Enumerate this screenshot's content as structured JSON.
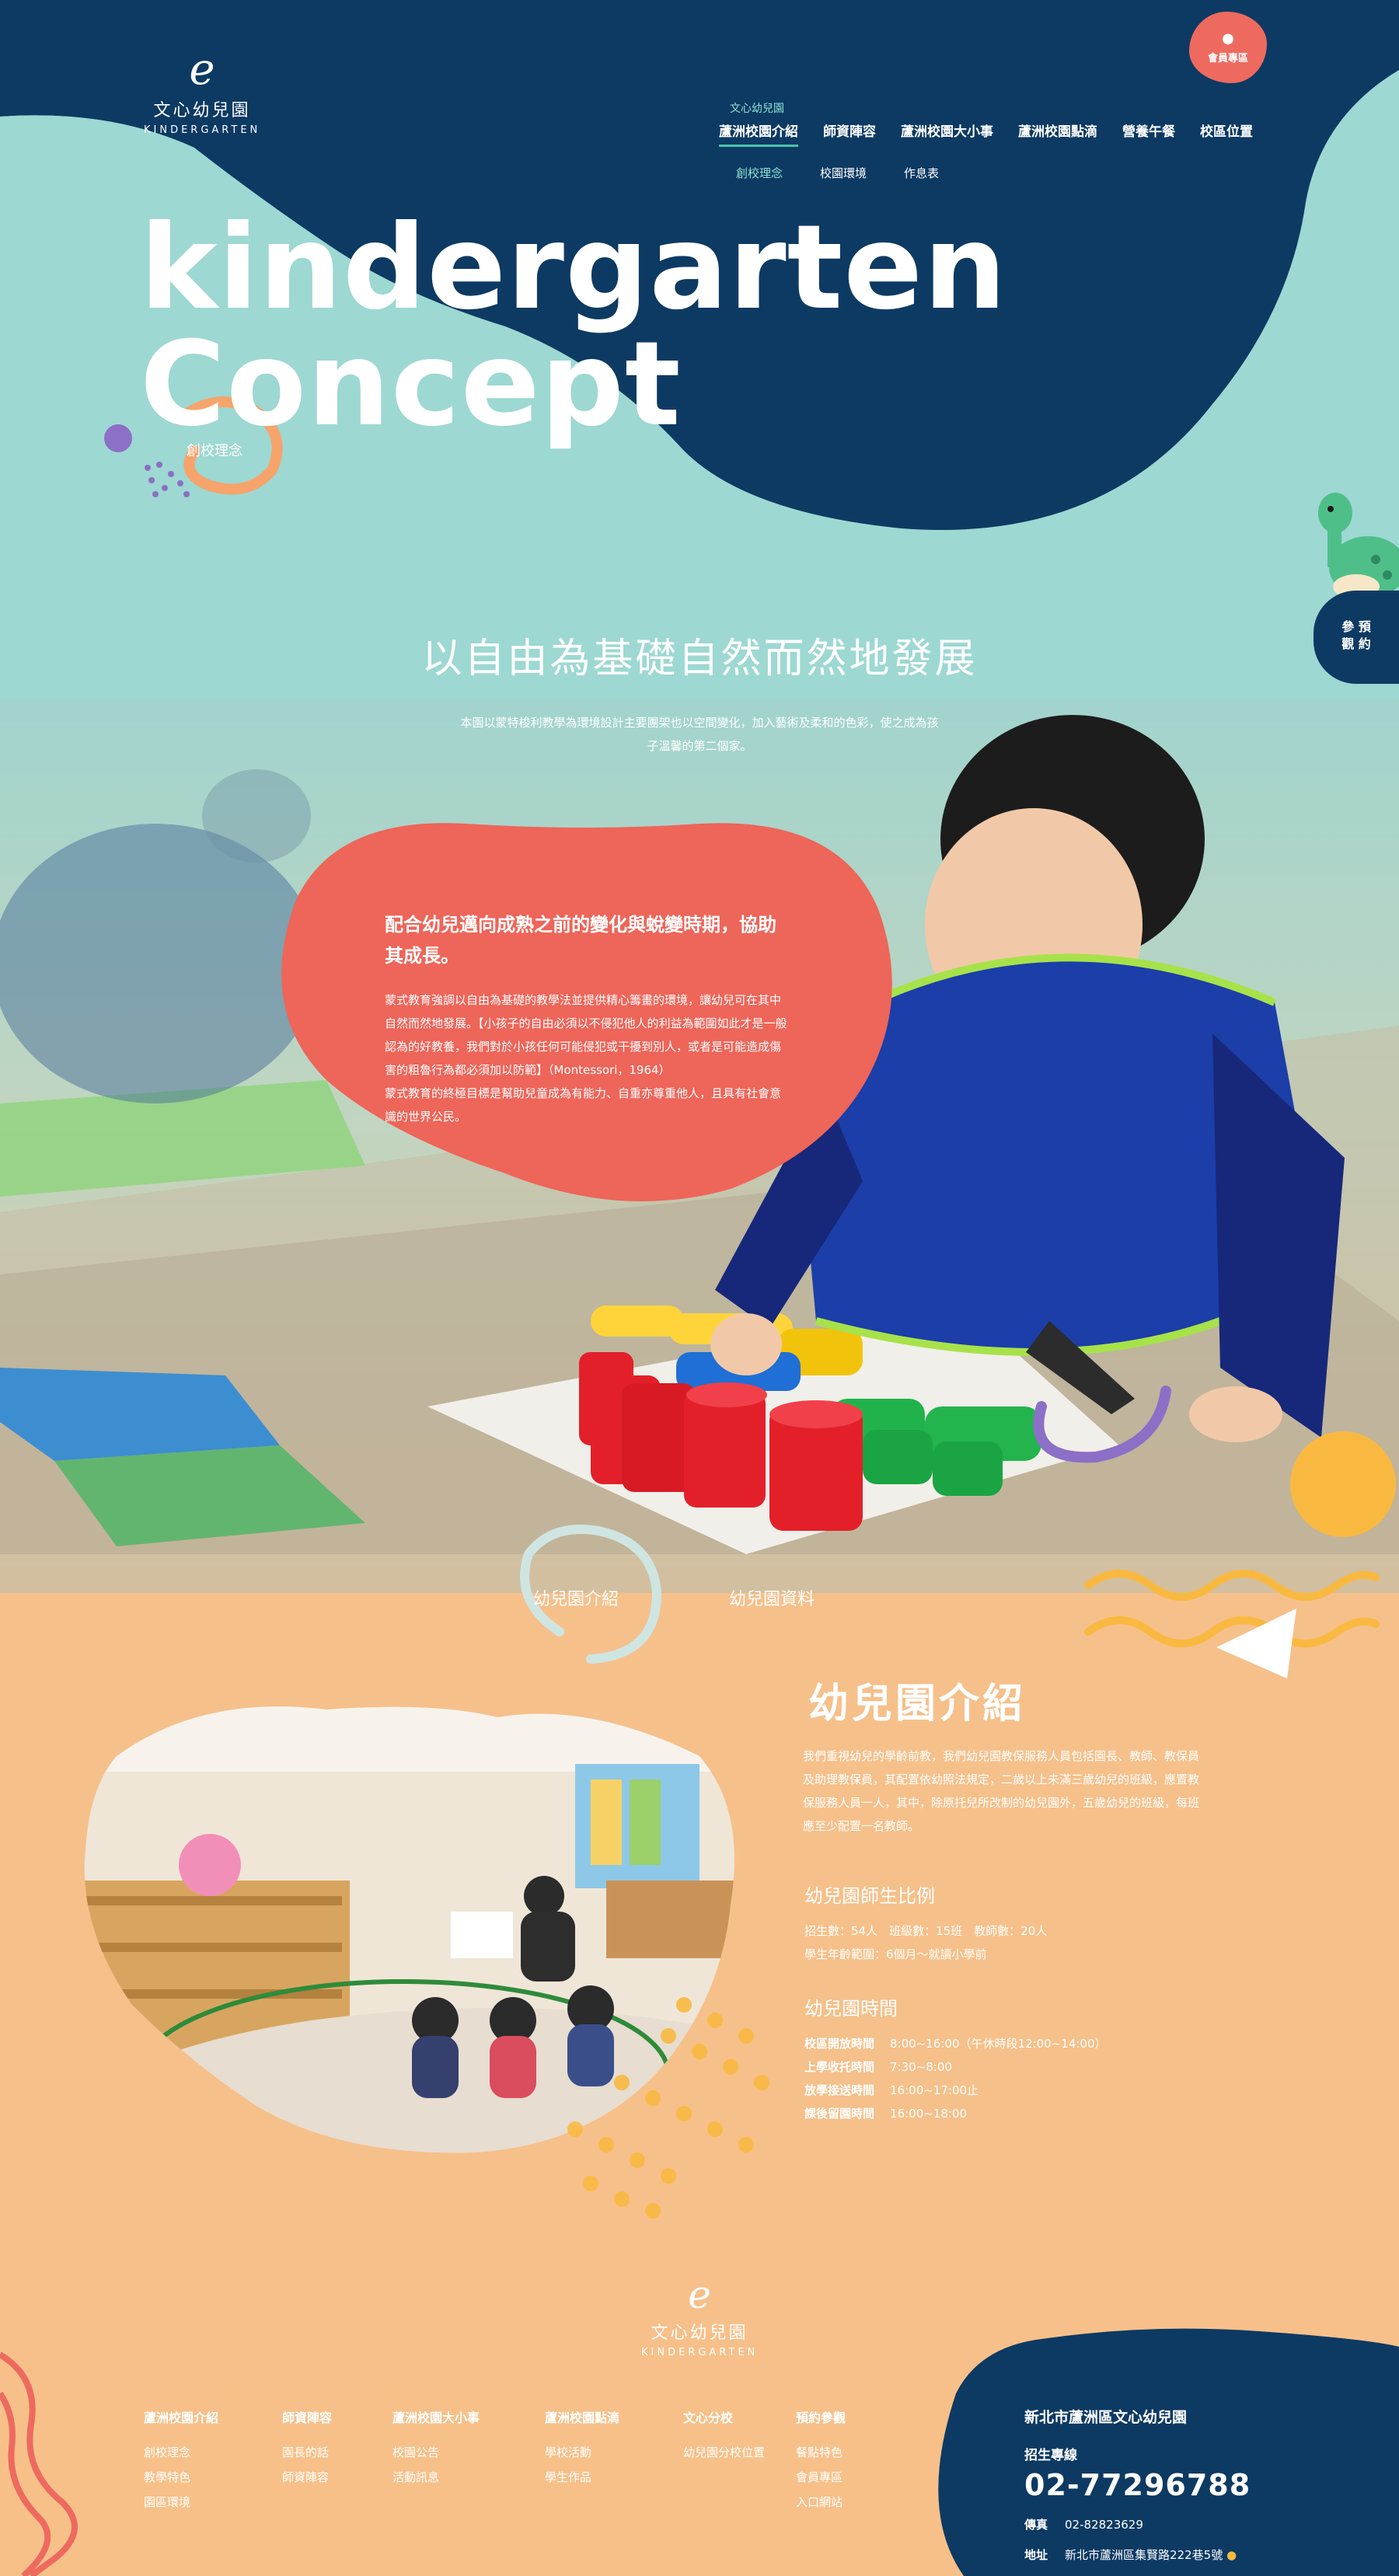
{
  "brand": {
    "logo_glyph": "e",
    "name": "文心幼兒園",
    "sub": "KINDERGARTEN"
  },
  "member_button": {
    "icon": "user-icon",
    "label": "會員專區"
  },
  "nav": {
    "items": [
      {
        "label": "蘆洲校園介紹",
        "over": "文心幼兒園",
        "active": true
      },
      {
        "label": "師資陣容"
      },
      {
        "label": "蘆洲校園大小事"
      },
      {
        "label": "蘆洲校園點滴"
      },
      {
        "label": "營養午餐"
      },
      {
        "label": "校區位置"
      }
    ],
    "sub_items": [
      {
        "label": "創校理念",
        "active": true
      },
      {
        "label": "校園環境"
      },
      {
        "label": "作息表"
      }
    ]
  },
  "hero": {
    "line1": "kindergarten",
    "line2": "Concept",
    "subtitle": "創校理念"
  },
  "side_button": {
    "line1": "參 預",
    "line2": "觀 約"
  },
  "concept": {
    "title": "以自由為基礎自然而然地發展",
    "desc": "本園以蒙特梭利教學為環境設計主要團架也以空間變化，加入藝術及柔和的色彩，使之成為孩子溫馨的第二個家。",
    "card_title": "配合幼兒邁向成熟之前的變化與蛻變時期，協助其成長。",
    "card_body_1": "蒙式教育強調以自由為基礎的教學法並提供精心籌畫的環境，讓幼兒可在其中自然而然地發展。【小孩子的自由必須以不侵犯他人的利益為範圍如此才是一般認為的好教養，我們對於小孩任何可能侵犯或干擾到別人，或者是可能造成傷害的粗魯行為都必須加以防範】（Montessori，1964）",
    "card_body_2": "蒙式教育的終極目標是幫助兒童成為有能力、自重亦尊重他人，且具有社會意識的世界公民。"
  },
  "intro": {
    "tabs": [
      "幼兒園介紹",
      "幼兒園資料"
    ],
    "title": "幼兒園介紹",
    "body": "我們重視幼兒的學齡前教，我們幼兒園教保服務人員包括園長、教師、教保員及助理教保員，其配置依幼照法規定，二歲以上未滿三歲幼兒的班級，應置教保服務人員一人，其中，除原托兒所改制的幼兒園外，五歲幼兒的班級，每班應至少配置一名教師。",
    "ratio_title": "幼兒園師生比例",
    "ratio_line1": "招生數：54人　班級數：15班　教師數：20人",
    "ratio_line2": "學生年齡範圍：6個月～就讀小學前",
    "time_title": "幼兒園時間",
    "times": [
      {
        "k": "校區開放時間",
        "v": "8:00~16:00（午休時段12:00~14:00）"
      },
      {
        "k": "上學收托時間",
        "v": "7:30~8:00"
      },
      {
        "k": "放學接送時間",
        "v": "16:00~17:00止"
      },
      {
        "k": "課後留園時間",
        "v": "16:00~18:00"
      }
    ]
  },
  "footer": {
    "columns": [
      {
        "head": "蘆洲校園介紹",
        "items": [
          "創校理念",
          "教學特色",
          "園區環境"
        ]
      },
      {
        "head": "師資陣容",
        "items": [
          "園長的話",
          "師資陣容"
        ]
      },
      {
        "head": "蘆洲校園大小事",
        "items": [
          "校園公告",
          "活動訊息"
        ]
      },
      {
        "head": "蘆洲校園點滴",
        "items": [
          "學校活動",
          "學生作品"
        ]
      },
      {
        "head": "文心分校",
        "items": [
          "幼兒園分校位置"
        ]
      },
      {
        "head": "預約參觀",
        "items": [
          "餐點特色",
          "會員專區",
          "入口網站"
        ]
      }
    ],
    "school": "新北市蘆洲區文心幼兒園",
    "hotline_label": "招生專線",
    "phone": "02-77296788",
    "fax_label": "傳真",
    "fax": "02-82823629",
    "addr_label": "地址",
    "addr": "新北市蘆洲區集賢路222巷5號"
  },
  "colors": {
    "navy": "#0d3a63",
    "mint": "#9dd8d2",
    "coral": "#ee6a5f",
    "peach": "#f6c08b",
    "yellow": "#f9b941",
    "purple": "#8c6fc6"
  }
}
